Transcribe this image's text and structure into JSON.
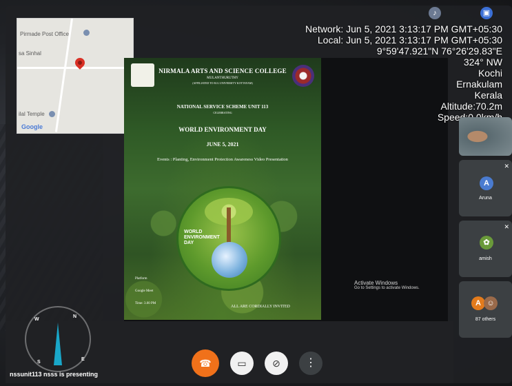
{
  "map": {
    "labels": [
      "Pirmade Post Office",
      "sa Sinhal",
      "ilal Temple",
      "Google"
    ],
    "pin_color": "#d93025"
  },
  "overlay": {
    "network": "Network: Jun 5, 2021 3:13:17 PM GMT+05:30",
    "local": "Local: Jun 5, 2021 3:13:17 PM GMT+05:30",
    "coords": "9°59'47.921\"N 76°26'29.83\"E",
    "heading": "324° NW",
    "city": "Kochi",
    "district": "Ernakulam",
    "state": "Kerala",
    "altitude": "Altitude:70.2m",
    "speed": "Speed:0.0km/h"
  },
  "poster": {
    "college": "NIRMALA ARTS AND SCIENCE COLLEGE",
    "sub1": "MULANTHURUTHY",
    "sub2": "(AFFILIATED TO M.G UNIVERSITY KOTTAYAM)",
    "nss": "NATIONAL SERVICE SCHEME UNIT 113",
    "nss2": "CELEBRATING",
    "event_title": "WORLD ENVIRONMENT DAY",
    "date": "JUNE 5, 2021",
    "events": "Events : Planting, Environment Protection Awareness Video Presentation",
    "badge_text": "WORLD ENVIRONMENT DAY",
    "platform_label": "Platform",
    "platform": "Google Meet",
    "time": "Time: 3.00 PM",
    "invite": "ALL ARE CORDIALLY INVITED"
  },
  "activate_windows": {
    "title": "Activate Windows",
    "subtitle": "Go to Settings to activate Windows."
  },
  "participants": [
    {
      "initial": "A",
      "name": "Aruna",
      "color": "#4a7bd0"
    },
    {
      "name": "amish"
    },
    {
      "initial": "A",
      "name": "87 others",
      "color": "#e37b1c"
    }
  ],
  "presenting": "nssunit113 nsss is presenting",
  "compass": {
    "n": "N",
    "e": "E",
    "s": "S",
    "w": "W"
  },
  "controls": {
    "end_icon": "phone-end-icon",
    "camera_icon": "camera-off-icon",
    "mic_icon": "mic-off-icon",
    "more_icon": "more-vertical-icon"
  }
}
